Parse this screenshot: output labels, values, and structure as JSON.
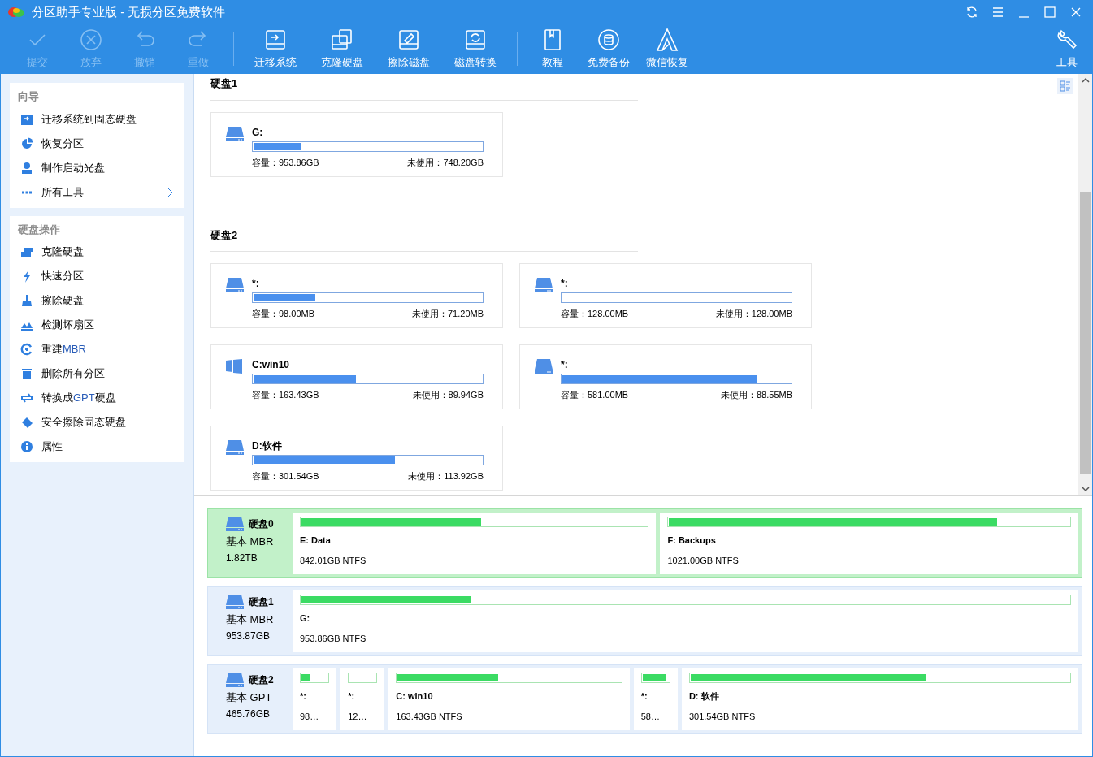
{
  "window": {
    "title": "分区助手专业版 - 无损分区免费软件"
  },
  "toolbar": {
    "groups": [
      [
        {
          "label": "提交",
          "disabled": true
        },
        {
          "label": "放弃",
          "disabled": true
        },
        {
          "label": "撤销",
          "disabled": true
        },
        {
          "label": "重做",
          "disabled": true
        }
      ],
      [
        {
          "label": "迁移系统",
          "disabled": false
        },
        {
          "label": "克隆硬盘",
          "disabled": false
        },
        {
          "label": "擦除磁盘",
          "disabled": false
        },
        {
          "label": "磁盘转换",
          "disabled": false
        }
      ],
      [
        {
          "label": "教程",
          "disabled": false
        },
        {
          "label": "免费备份",
          "disabled": false
        },
        {
          "label": "微信恢复",
          "disabled": false
        }
      ]
    ],
    "tools": {
      "label": "工具"
    }
  },
  "sidebar": {
    "sections": [
      {
        "title": "向导",
        "items": [
          {
            "label": "迁移系统到固态硬盘",
            "arrow": false
          },
          {
            "label": "恢复分区",
            "arrow": false
          },
          {
            "label": "制作启动光盘",
            "arrow": false
          },
          {
            "label": "所有工具",
            "arrow": true
          }
        ]
      },
      {
        "title": "硬盘操作",
        "items": [
          {
            "label": "克隆硬盘",
            "arrow": false
          },
          {
            "label": "快速分区",
            "arrow": false
          },
          {
            "label": "擦除硬盘",
            "arrow": false
          },
          {
            "label": "检测坏扇区",
            "arrow": false
          },
          {
            "label": "重建**MBR**",
            "arrow": false
          },
          {
            "label": "删除所有分区",
            "arrow": false
          },
          {
            "label": "转换成**GPT**硬盘",
            "arrow": false
          },
          {
            "label": "安全擦除固态硬盘",
            "arrow": false
          },
          {
            "label": "属性",
            "arrow": false
          }
        ]
      }
    ]
  },
  "disk_cards": [
    {
      "title": "硬盘1",
      "partitions": [
        {
          "kind": "drive",
          "name": "G:",
          "level": 0.21,
          "capacity": "容量：953.86GB",
          "unused": "未使用：748.20GB"
        }
      ]
    },
    {
      "title": "硬盘2",
      "partitions": [
        {
          "kind": "drive",
          "name": "*:",
          "level": 0.27,
          "capacity": "容量：98.00MB",
          "unused": "未使用：71.20MB"
        },
        {
          "kind": "drive",
          "name": "*:",
          "level": 0.0,
          "capacity": "容量：128.00MB",
          "unused": "未使用：128.00MB"
        },
        {
          "kind": "windows",
          "name": "C:win10",
          "level": 0.45,
          "capacity": "容量：163.43GB",
          "unused": "未使用：89.94GB"
        },
        {
          "kind": "drive",
          "name": "*:",
          "level": 0.85,
          "capacity": "容量：581.00MB",
          "unused": "未使用：88.55MB"
        },
        {
          "kind": "drive",
          "name": "D:软件",
          "level": 0.62,
          "capacity": "容量：301.54GB",
          "unused": "未使用：113.92GB"
        }
      ]
    }
  ],
  "disk_map": [
    {
      "name": "硬盘0",
      "type": "基本 MBR",
      "size": "1.82TB",
      "selected": true,
      "partitions": [
        {
          "name": "E: Data",
          "info": "842.01GB NTFS",
          "level": 0.52
        },
        {
          "name": "F: Backups",
          "info": "1021.00GB NTFS",
          "level": 0.82
        }
      ]
    },
    {
      "name": "硬盘1",
      "type": "基本 MBR",
      "size": "953.87GB",
      "selected": false,
      "partitions": [
        {
          "name": "G:",
          "info": "953.86GB NTFS",
          "level": 0.22
        }
      ]
    },
    {
      "name": "硬盘2",
      "type": "基本 GPT",
      "size": "465.76GB",
      "selected": false,
      "partitions": [
        {
          "name": "*:",
          "info": "98…",
          "level": 0.3
        },
        {
          "name": "*:",
          "info": "12…",
          "level": 0.0
        },
        {
          "name": "C: win10",
          "info": "163.43GB NTFS",
          "level": 0.45
        },
        {
          "name": "*:",
          "info": "58…",
          "level": 0.9
        },
        {
          "name": "D: 软件",
          "info": "301.54GB NTFS",
          "level": 0.62
        }
      ]
    }
  ]
}
